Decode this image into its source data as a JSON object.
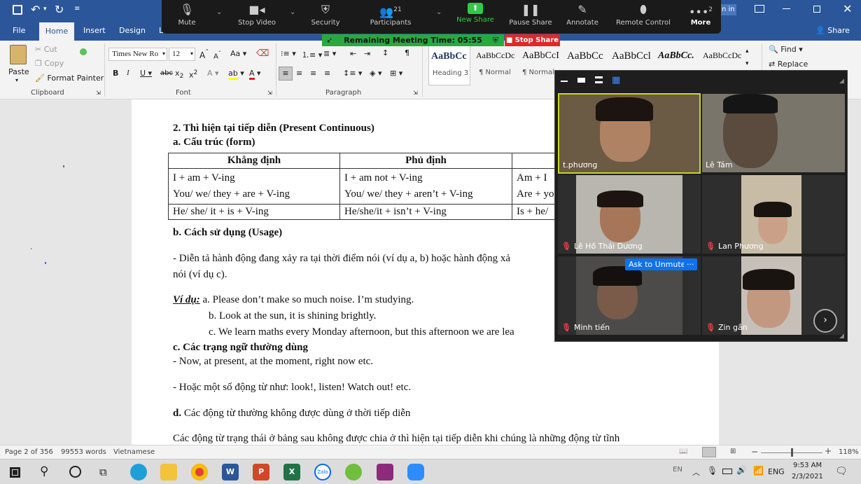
{
  "menu": {
    "tabs": [
      "File",
      "Home",
      "Insert",
      "Design",
      "L"
    ],
    "share": "Share",
    "sign_in": "n in"
  },
  "ribbon": {
    "clipboard": {
      "paste": "Paste",
      "cut": "Cut",
      "copy": "Copy",
      "format_painter": "Format Painter",
      "label": "Clipboard"
    },
    "font": {
      "name": "Times New Ro",
      "size": "12",
      "label": "Font"
    },
    "paragraph": {
      "label": "Paragraph"
    },
    "styles": [
      {
        "preview": "AaBbCc",
        "name": "Heading 3"
      },
      {
        "preview": "AaBbCcDc",
        "name": "¶ Normal"
      },
      {
        "preview": "AaBbCcI",
        "name": "¶ Normal..."
      },
      {
        "preview": "AaBbCc",
        "name": ""
      },
      {
        "preview": "AaBbCcl",
        "name": ""
      },
      {
        "preview": "AaBbCc.",
        "name": ""
      },
      {
        "preview": "AaBbCcDc",
        "name": ""
      }
    ],
    "editing": {
      "find": "Find",
      "replace": "Replace"
    }
  },
  "zoom": {
    "toolbar": [
      {
        "label": "Mute",
        "icon": "mic-icon"
      },
      {
        "label": "Stop Video",
        "icon": "video-icon"
      },
      {
        "label": "Security",
        "icon": "shield-icon"
      },
      {
        "label": "Participants",
        "icon": "participants-icon",
        "badge": "21"
      },
      {
        "label": "New Share",
        "icon": "share-up-icon"
      },
      {
        "label": "Pause Share",
        "icon": "pause-icon"
      },
      {
        "label": "Annotate",
        "icon": "pen-icon"
      },
      {
        "label": "Remote Control",
        "icon": "mouse-icon"
      },
      {
        "label": "More",
        "icon": "more-icon",
        "badge": "2"
      }
    ],
    "timer": "Remaining Meeting Time: 05:55",
    "stop_share": "Stop Share",
    "ask_unmute": "Ask to Unmute",
    "ask_more": "···",
    "participants": [
      {
        "name": "t.phương",
        "muted": false
      },
      {
        "name": "Lê Tám",
        "muted": false
      },
      {
        "name": "Lê Hồ Thái Dương",
        "muted": true
      },
      {
        "name": "Lan Phương",
        "muted": true
      },
      {
        "name": "Minh tiến",
        "muted": true
      },
      {
        "name": "Zin gắn",
        "muted": true
      }
    ]
  },
  "doc": {
    "heading2": "2. Thì hiện tại tiếp diễn (Present Continuous)",
    "heading_a": "a. Cấu trúc (form)",
    "table": {
      "headers": [
        "Khẳng định",
        "Phủ định",
        ""
      ],
      "rows": [
        [
          "I + am + V-ing",
          "I + am not + V-ing",
          "Am + I"
        ],
        [
          "You/ we/ they + are + V-ing",
          "You/ we/ they + aren’t + V-ing",
          "Are + yo"
        ],
        [
          "He/ she/ it + is + V-ing",
          "He/she/it + isn’t + V-ing",
          "Is + he/"
        ]
      ]
    },
    "heading_b": "b. Cách sử dụng (Usage)",
    "usage1": "-  Diễn tả hành động đang xảy ra tại thời điểm nói (ví dụ a, b) hoặc hành động xả",
    "usage2": "nói (ví dụ c).",
    "vidu_label": "Ví dụ:",
    "ex_a": " a. Please don’t make so much noise. I’m studying.",
    "ex_b": "b. Look at the sun, it is shining brightly.",
    "ex_c": "c. We learn maths every Monday afternoon, but this afternoon we are lea",
    "heading_c": "c. Các trạng ngữ thường dùng",
    "adv1": "- Now, at present, at the moment, right now etc.",
    "adv2": "- Hoặc một số động từ như: look!, listen! Watch out! etc.",
    "heading_d_bold": "d.",
    "heading_d": " Các động từ thường không được dùng ở thời tiếp diễn",
    "last": "Các động từ trạng thái ở bảng sau không được chia ở thì hiện tại tiếp diễn khi chúng là những động từ  tĩnh"
  },
  "status": {
    "page": "Page 2 of 356",
    "words": "99553 words",
    "lang": "Vietnamese",
    "zoom": "118%"
  },
  "taskbar": {
    "lang": "ENG",
    "time": "9:53 AM",
    "date": "2/3/2021",
    "ime": "EN"
  },
  "colors": {
    "word_blue": "#2b579a",
    "zoom_green": "#2aa840",
    "zoom_red": "#e02828",
    "unmute_blue": "#0e72ed"
  }
}
